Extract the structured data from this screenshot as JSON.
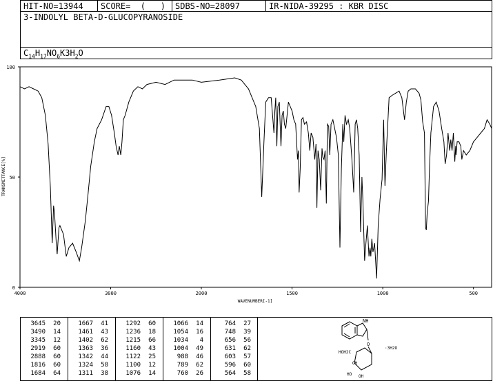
{
  "header": {
    "hit_no": "HIT-NO=13944",
    "score": "SCORE=  (   )",
    "sdbs_no": "SDBS-NO=28097",
    "method": "IR-NIDA-39295 : KBR DISC"
  },
  "compound_name": "3-INDOLYL BETA-D-GLUCOPYRANOSIDE",
  "formula": {
    "parts": [
      "C",
      "14",
      "H",
      "17",
      "NO",
      "6",
      "K3H",
      "2",
      "O"
    ]
  },
  "structure_labels": {
    "nh": "NH",
    "hoh2c": "HOH2C",
    "oh1": "OH",
    "ho": "HO",
    "oh2": "OH",
    "water": "·3H2O"
  },
  "chart_data": {
    "type": "line",
    "xlabel": "WAVENUMBER[-1]",
    "ylabel": "TRANSMITTANCE[%]",
    "xlim": [
      4000,
      400
    ],
    "ylim": [
      0,
      100
    ],
    "x_ticks": [
      "4000",
      "3000",
      "2000",
      "1500",
      "1000",
      "500"
    ],
    "y_ticks": [
      "100",
      "50",
      "0"
    ],
    "grid": false,
    "series": [
      {
        "points": [
          [
            4000,
            91
          ],
          [
            3950,
            90
          ],
          [
            3900,
            91
          ],
          [
            3850,
            90
          ],
          [
            3800,
            89
          ],
          [
            3760,
            86
          ],
          [
            3720,
            78
          ],
          [
            3690,
            65
          ],
          [
            3665,
            45
          ],
          [
            3645,
            20
          ],
          [
            3630,
            37
          ],
          [
            3620,
            34
          ],
          [
            3600,
            20
          ],
          [
            3590,
            15
          ],
          [
            3570,
            27
          ],
          [
            3560,
            28
          ],
          [
            3520,
            24
          ],
          [
            3490,
            14
          ],
          [
            3460,
            18
          ],
          [
            3420,
            20
          ],
          [
            3380,
            16
          ],
          [
            3345,
            12
          ],
          [
            3320,
            18
          ],
          [
            3280,
            30
          ],
          [
            3250,
            42
          ],
          [
            3220,
            55
          ],
          [
            3180,
            66
          ],
          [
            3150,
            72
          ],
          [
            3100,
            76
          ],
          [
            3050,
            82
          ],
          [
            3020,
            82
          ],
          [
            2990,
            78
          ],
          [
            2960,
            70
          ],
          [
            2940,
            64
          ],
          [
            2919,
            60
          ],
          [
            2905,
            64
          ],
          [
            2888,
            60
          ],
          [
            2875,
            66
          ],
          [
            2860,
            76
          ],
          [
            2840,
            78
          ],
          [
            2800,
            84
          ],
          [
            2750,
            89
          ],
          [
            2700,
            91
          ],
          [
            2650,
            90
          ],
          [
            2600,
            92
          ],
          [
            2500,
            93
          ],
          [
            2400,
            92
          ],
          [
            2300,
            94
          ],
          [
            2200,
            94
          ],
          [
            2100,
            94
          ],
          [
            2000,
            93
          ],
          [
            1900,
            94
          ],
          [
            1816,
            95
          ],
          [
            1780,
            94
          ],
          [
            1740,
            90
          ],
          [
            1700,
            82
          ],
          [
            1680,
            72
          ],
          [
            1667,
            41
          ],
          [
            1655,
            66
          ],
          [
            1645,
            84
          ],
          [
            1630,
            86
          ],
          [
            1615,
            86
          ],
          [
            1600,
            70
          ],
          [
            1595,
            80
          ],
          [
            1590,
            86
          ],
          [
            1584,
            64
          ],
          [
            1578,
            82
          ],
          [
            1570,
            84
          ],
          [
            1561,
            64
          ],
          [
            1555,
            78
          ],
          [
            1548,
            80
          ],
          [
            1542,
            74
          ],
          [
            1535,
            72
          ],
          [
            1520,
            84
          ],
          [
            1510,
            82
          ],
          [
            1500,
            80
          ],
          [
            1490,
            76
          ],
          [
            1480,
            74
          ],
          [
            1470,
            58
          ],
          [
            1465,
            62
          ],
          [
            1461,
            43
          ],
          [
            1455,
            54
          ],
          [
            1448,
            76
          ],
          [
            1440,
            77
          ],
          [
            1432,
            74
          ],
          [
            1420,
            75
          ],
          [
            1410,
            70
          ],
          [
            1402,
            62
          ],
          [
            1395,
            70
          ],
          [
            1385,
            68
          ],
          [
            1375,
            58
          ],
          [
            1368,
            65
          ],
          [
            1363,
            36
          ],
          [
            1357,
            62
          ],
          [
            1350,
            58
          ],
          [
            1342,
            44
          ],
          [
            1335,
            63
          ],
          [
            1330,
            59
          ],
          [
            1324,
            58
          ],
          [
            1318,
            62
          ],
          [
            1311,
            38
          ],
          [
            1305,
            74
          ],
          [
            1298,
            73
          ],
          [
            1292,
            60
          ],
          [
            1285,
            74
          ],
          [
            1275,
            76
          ],
          [
            1265,
            72
          ],
          [
            1255,
            68
          ],
          [
            1245,
            60
          ],
          [
            1236,
            18
          ],
          [
            1228,
            54
          ],
          [
            1220,
            74
          ],
          [
            1215,
            66
          ],
          [
            1208,
            78
          ],
          [
            1200,
            74
          ],
          [
            1190,
            76
          ],
          [
            1182,
            72
          ],
          [
            1170,
            58
          ],
          [
            1160,
            43
          ],
          [
            1152,
            74
          ],
          [
            1145,
            76
          ],
          [
            1138,
            72
          ],
          [
            1130,
            60
          ],
          [
            1122,
            25
          ],
          [
            1115,
            50
          ],
          [
            1110,
            40
          ],
          [
            1100,
            12
          ],
          [
            1093,
            20
          ],
          [
            1085,
            28
          ],
          [
            1076,
            14
          ],
          [
            1070,
            18
          ],
          [
            1066,
            14
          ],
          [
            1060,
            22
          ],
          [
            1054,
            16
          ],
          [
            1045,
            20
          ],
          [
            1034,
            4
          ],
          [
            1025,
            28
          ],
          [
            1015,
            40
          ],
          [
            1004,
            49
          ],
          [
            995,
            76
          ],
          [
            988,
            46
          ],
          [
            980,
            62
          ],
          [
            965,
            86
          ],
          [
            950,
            87
          ],
          [
            930,
            88
          ],
          [
            910,
            89
          ],
          [
            895,
            86
          ],
          [
            880,
            76
          ],
          [
            870,
            84
          ],
          [
            860,
            89
          ],
          [
            845,
            90
          ],
          [
            820,
            90
          ],
          [
            800,
            88
          ],
          [
            790,
            85
          ],
          [
            780,
            75
          ],
          [
            770,
            70
          ],
          [
            764,
            27
          ],
          [
            760,
            26
          ],
          [
            755,
            34
          ],
          [
            748,
            39
          ],
          [
            742,
            55
          ],
          [
            735,
            70
          ],
          [
            720,
            82
          ],
          [
            705,
            84
          ],
          [
            690,
            80
          ],
          [
            675,
            72
          ],
          [
            663,
            66
          ],
          [
            656,
            56
          ],
          [
            648,
            60
          ],
          [
            640,
            70
          ],
          [
            631,
            62
          ],
          [
            625,
            67
          ],
          [
            618,
            62
          ],
          [
            611,
            70
          ],
          [
            603,
            57
          ],
          [
            598,
            64
          ],
          [
            596,
            60
          ],
          [
            590,
            66
          ],
          [
            580,
            66
          ],
          [
            570,
            64
          ],
          [
            564,
            58
          ],
          [
            555,
            62
          ],
          [
            540,
            60
          ],
          [
            520,
            62
          ],
          [
            500,
            66
          ],
          [
            480,
            68
          ],
          [
            460,
            70
          ],
          [
            440,
            72
          ],
          [
            425,
            76
          ],
          [
            410,
            74
          ],
          [
            400,
            72
          ]
        ]
      }
    ]
  },
  "peak_table": {
    "columns": [
      [
        [
          "3645",
          "20"
        ],
        [
          "3490",
          "14"
        ],
        [
          "3345",
          "12"
        ],
        [
          "2919",
          "60"
        ],
        [
          "2888",
          "60"
        ],
        [
          "1816",
          "60"
        ],
        [
          "1684",
          "64"
        ]
      ],
      [
        [
          "1667",
          "41"
        ],
        [
          "1461",
          "43"
        ],
        [
          "1402",
          "62"
        ],
        [
          "1363",
          "36"
        ],
        [
          "1342",
          "44"
        ],
        [
          "1324",
          "58"
        ],
        [
          "1311",
          "38"
        ]
      ],
      [
        [
          "1292",
          "60"
        ],
        [
          "1236",
          "18"
        ],
        [
          "1215",
          "66"
        ],
        [
          "1160",
          "43"
        ],
        [
          "1122",
          "25"
        ],
        [
          "1100",
          "12"
        ],
        [
          "1076",
          "14"
        ]
      ],
      [
        [
          "1066",
          "14"
        ],
        [
          "1054",
          "16"
        ],
        [
          "1034",
          "4"
        ],
        [
          "1004",
          "49"
        ],
        [
          "988",
          "46"
        ],
        [
          "789",
          "62"
        ],
        [
          "760",
          "26"
        ]
      ],
      [
        [
          "764",
          "27"
        ],
        [
          "748",
          "39"
        ],
        [
          "656",
          "56"
        ],
        [
          "631",
          "62"
        ],
        [
          "603",
          "57"
        ],
        [
          "596",
          "60"
        ],
        [
          "564",
          "58"
        ]
      ]
    ]
  }
}
